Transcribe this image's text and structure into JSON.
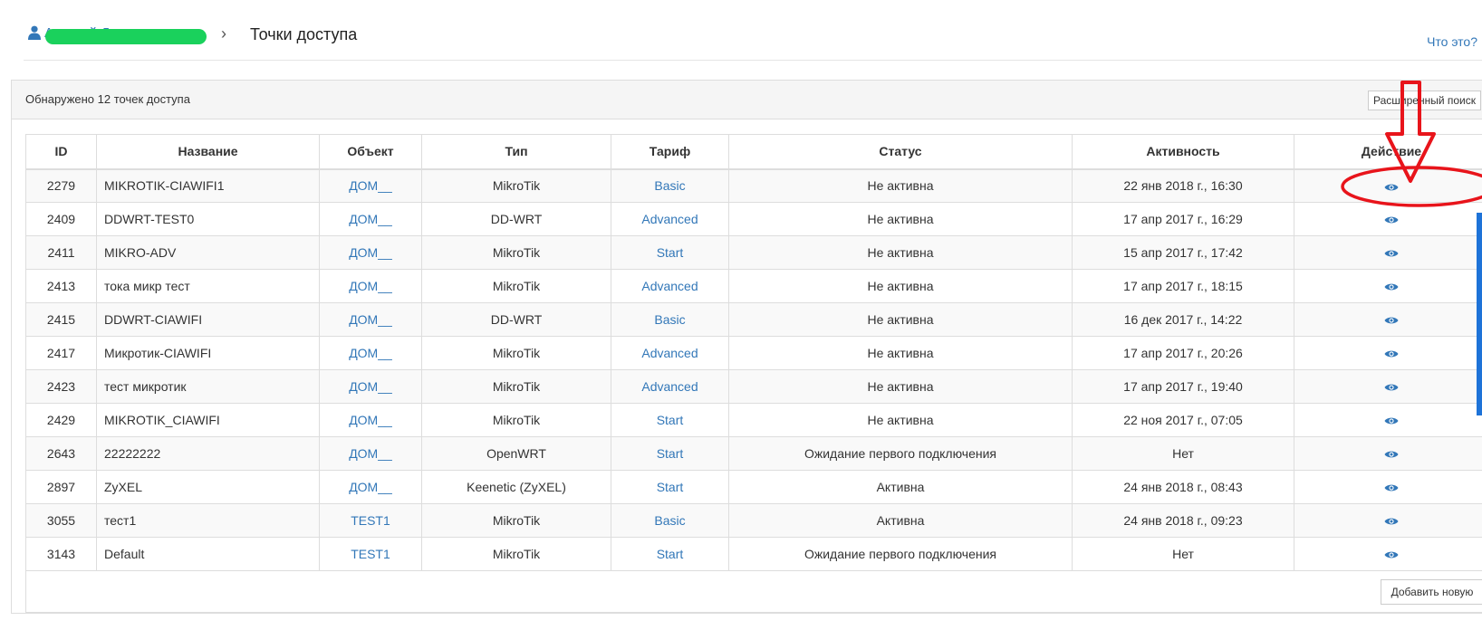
{
  "header": {
    "user_name": "Алексей Д",
    "separator": "›",
    "title": "Точки доступа",
    "help_link": "Что это?"
  },
  "panel": {
    "found_text": "Обнаружено 12 точек доступа",
    "advanced_search_label": "Расширенный поиск",
    "add_new_label": "Добавить новую"
  },
  "table": {
    "columns": [
      "ID",
      "Название",
      "Объект",
      "Тип",
      "Тариф",
      "Статус",
      "Активность",
      "Действие"
    ],
    "rows": [
      {
        "id": "2279",
        "name": "MIKROTIK-CIAWIFI1",
        "object": "ДОМ__",
        "type": "MikroTik",
        "tariff": "Basic",
        "status": "Не активна",
        "activity": "22 янв 2018 г., 16:30"
      },
      {
        "id": "2409",
        "name": "DDWRT-TEST0",
        "object": "ДОМ__",
        "type": "DD-WRT",
        "tariff": "Advanced",
        "status": "Не активна",
        "activity": "17 апр 2017 г., 16:29"
      },
      {
        "id": "2411",
        "name": "MIKRO-ADV",
        "object": "ДОМ__",
        "type": "MikroTik",
        "tariff": "Start",
        "status": "Не активна",
        "activity": "15 апр 2017 г., 17:42"
      },
      {
        "id": "2413",
        "name": "тока микр тест",
        "object": "ДОМ__",
        "type": "MikroTik",
        "tariff": "Advanced",
        "status": "Не активна",
        "activity": "17 апр 2017 г., 18:15"
      },
      {
        "id": "2415",
        "name": "DDWRT-CIAWIFI",
        "object": "ДОМ__",
        "type": "DD-WRT",
        "tariff": "Basic",
        "status": "Не активна",
        "activity": "16 дек 2017 г., 14:22"
      },
      {
        "id": "2417",
        "name": "Микротик-CIAWIFI",
        "object": "ДОМ__",
        "type": "MikroTik",
        "tariff": "Advanced",
        "status": "Не активна",
        "activity": "17 апр 2017 г., 20:26"
      },
      {
        "id": "2423",
        "name": "тест микротик",
        "object": "ДОМ__",
        "type": "MikroTik",
        "tariff": "Advanced",
        "status": "Не активна",
        "activity": "17 апр 2017 г., 19:40"
      },
      {
        "id": "2429",
        "name": "MIKROTIK_CIAWIFI",
        "object": "ДОМ__",
        "type": "MikroTik",
        "tariff": "Start",
        "status": "Не активна",
        "activity": "22 ноя 2017 г., 07:05"
      },
      {
        "id": "2643",
        "name": "22222222",
        "object": "ДОМ__",
        "type": "OpenWRT",
        "tariff": "Start",
        "status": "Ожидание первого подключения",
        "activity": "Нет"
      },
      {
        "id": "2897",
        "name": "ZyXEL",
        "object": "ДОМ__",
        "type": "Keenetic (ZyXEL)",
        "tariff": "Start",
        "status": "Активна",
        "activity": "24 янв 2018 г., 08:43"
      },
      {
        "id": "3055",
        "name": "тест1",
        "object": "TEST1",
        "type": "MikroTik",
        "tariff": "Basic",
        "status": "Активна",
        "activity": "24 янв 2018 г., 09:23"
      },
      {
        "id": "3143",
        "name": "Default",
        "object": "TEST1",
        "type": "MikroTik",
        "tariff": "Start",
        "status": "Ожидание первого подключения",
        "activity": "Нет"
      }
    ]
  },
  "icons": {
    "user": "user-icon",
    "view": "eye-icon"
  },
  "colors": {
    "link": "#3277b8",
    "annotation": "#e8141b",
    "redaction": "#1ad15c",
    "scroll_indicator": "#1e73d8"
  }
}
